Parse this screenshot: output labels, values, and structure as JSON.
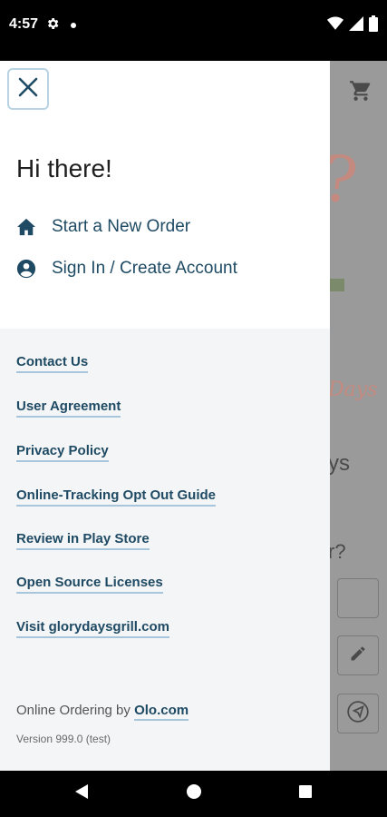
{
  "status_bar": {
    "time": "4:57"
  },
  "drawer": {
    "greeting": "Hi there!",
    "nav_items": [
      {
        "label": "Start a New Order",
        "icon": "home-icon"
      },
      {
        "label": "Sign In / Create Account",
        "icon": "account-circle-icon"
      }
    ],
    "links": [
      "Contact Us",
      "User Agreement",
      "Privacy Policy",
      "Online-Tracking Opt Out Guide",
      "Review in Play Store",
      "Open Source Licenses",
      "Visit glorydaysgrill.com"
    ],
    "footer": {
      "prefix": "Online Ordering by ",
      "link": "Olo.com",
      "version": "Version 999.0 (test)"
    }
  },
  "background": {
    "big_char": "?",
    "days_text": "Days",
    "ys_text": "ys",
    "r_text": "r?"
  },
  "colors": {
    "link": "#1e4a64",
    "link_underline": "#a7c6db",
    "close_border": "#b8d3e3"
  }
}
